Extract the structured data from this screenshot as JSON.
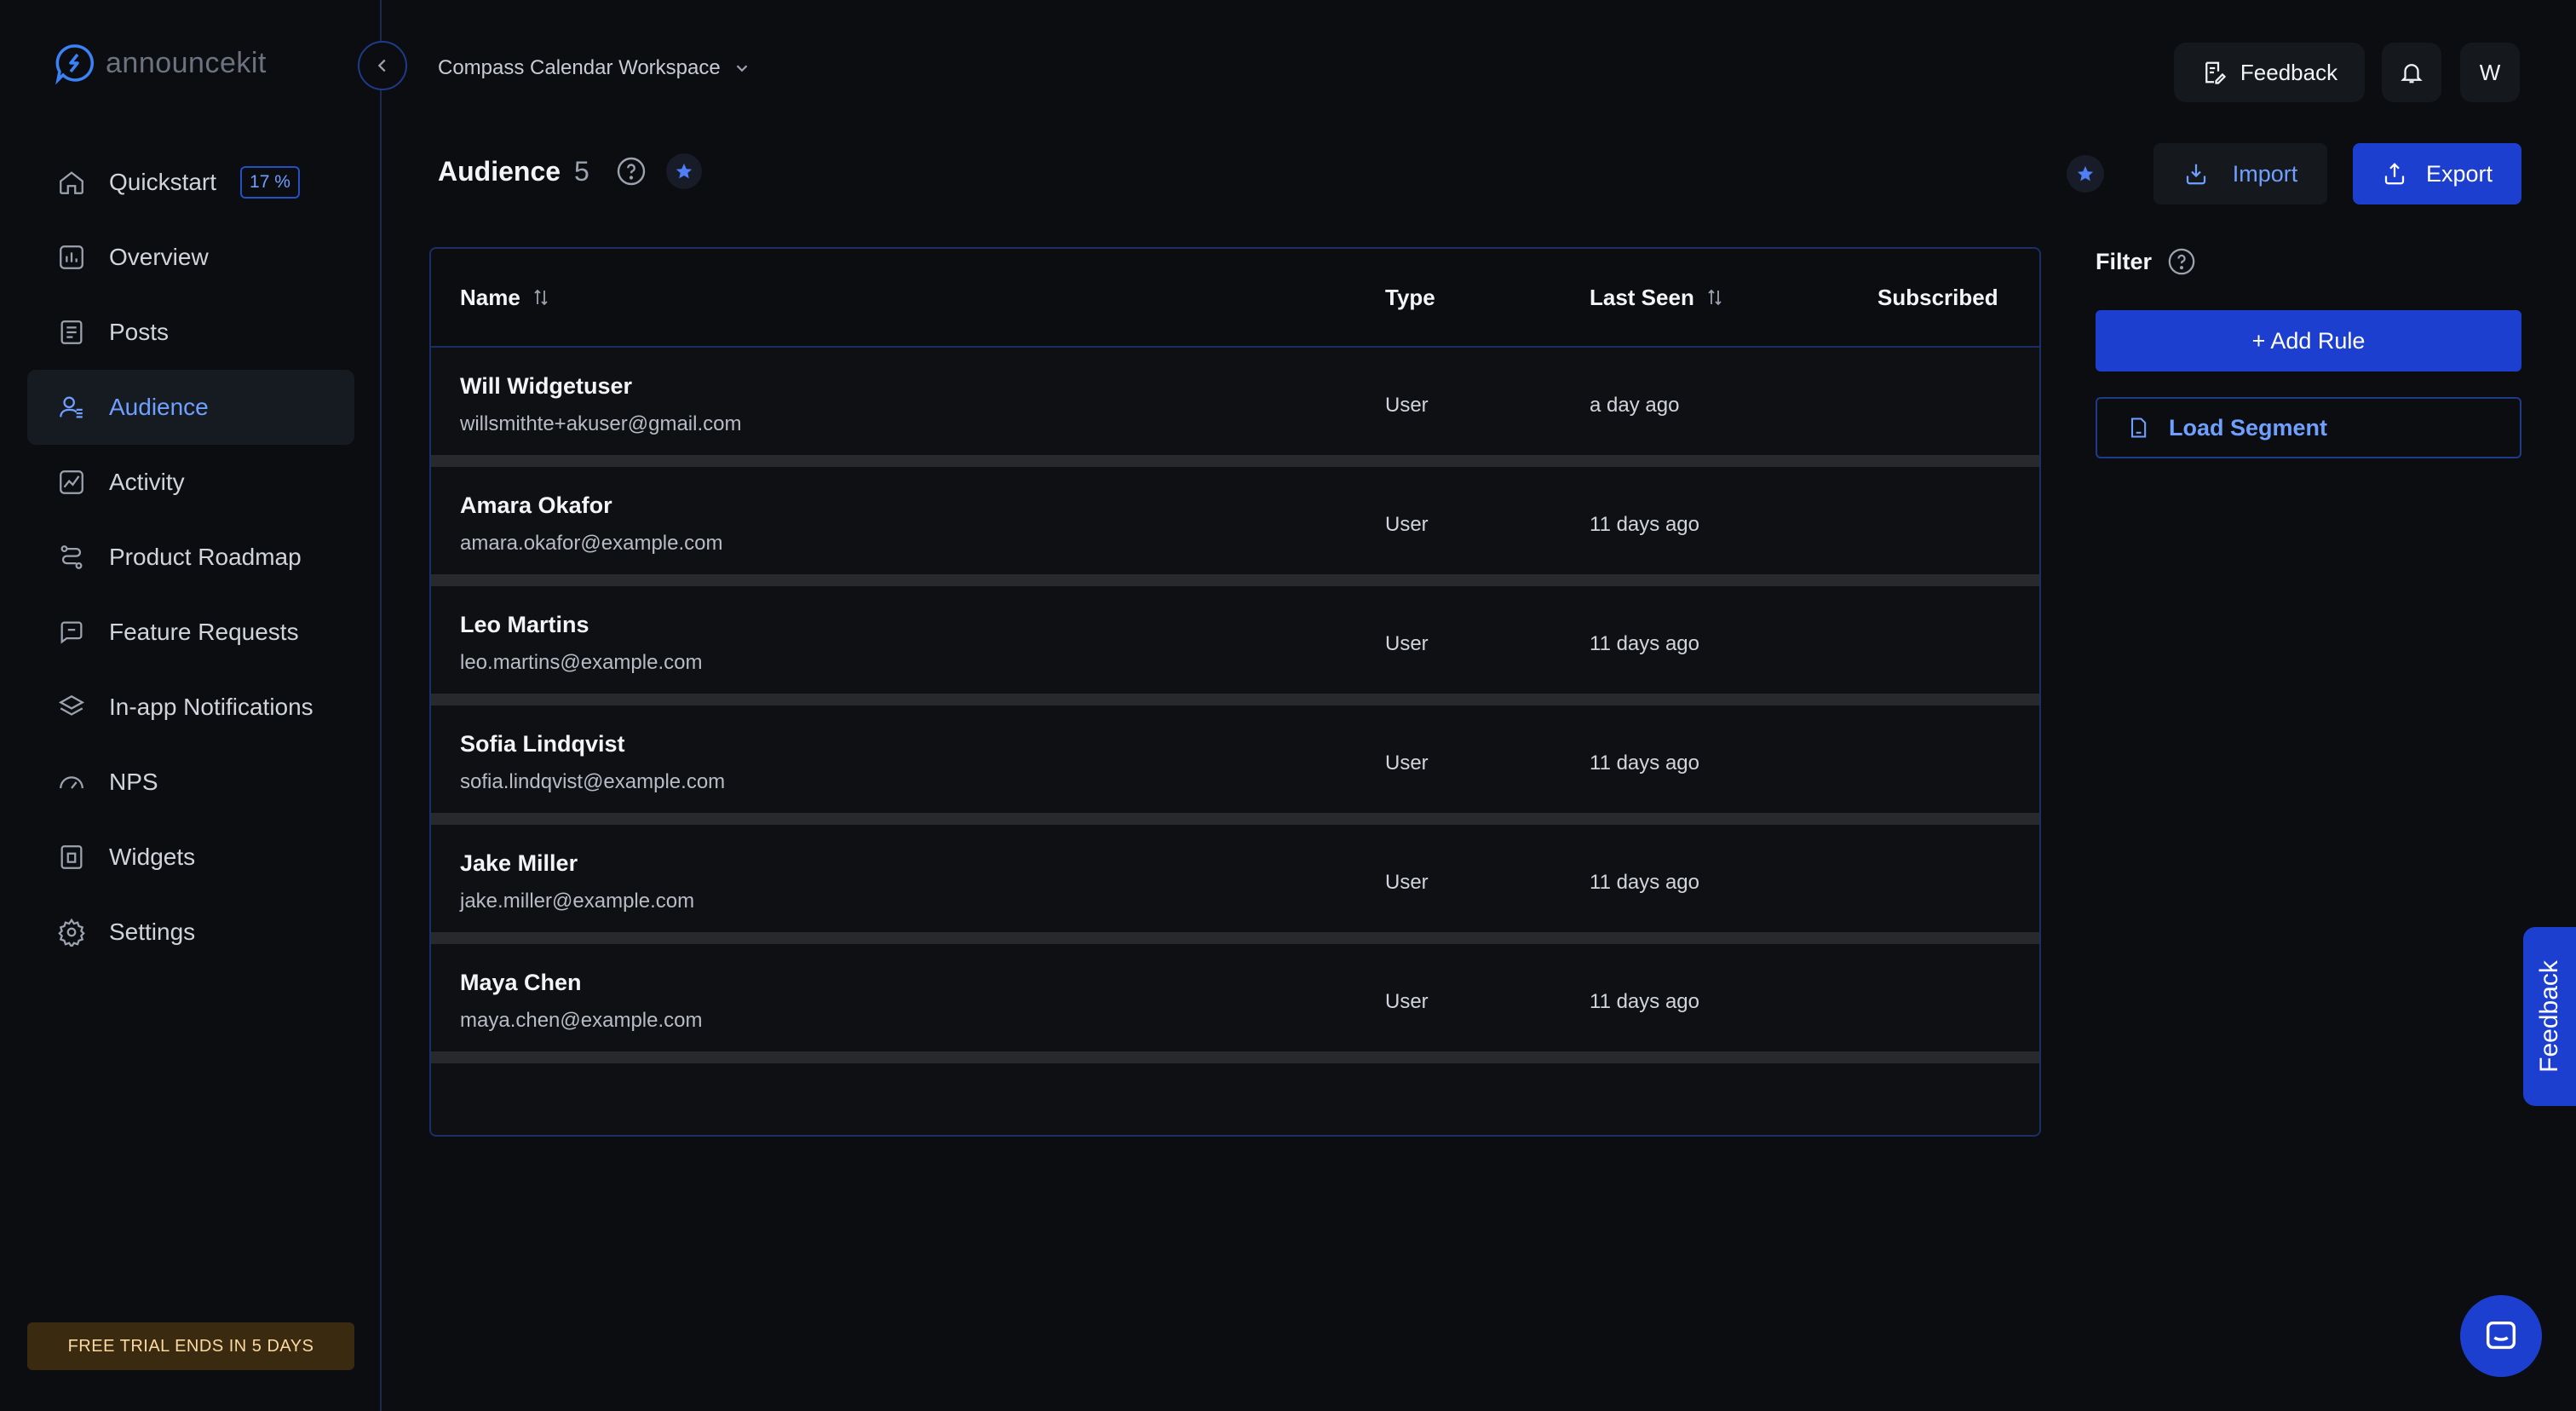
{
  "brand": {
    "name": "announcekit"
  },
  "sidebar": {
    "items": [
      {
        "label": "Quickstart",
        "icon": "home-icon",
        "badge": "17 %"
      },
      {
        "label": "Overview",
        "icon": "bar-chart-icon"
      },
      {
        "label": "Posts",
        "icon": "document-icon"
      },
      {
        "label": "Audience",
        "icon": "users-icon",
        "active": true
      },
      {
        "label": "Activity",
        "icon": "activity-chart-icon"
      },
      {
        "label": "Product Roadmap",
        "icon": "roadmap-icon"
      },
      {
        "label": "Feature Requests",
        "icon": "chat-bubble-icon"
      },
      {
        "label": "In-app Notifications",
        "icon": "layers-icon"
      },
      {
        "label": "NPS",
        "icon": "gauge-icon"
      },
      {
        "label": "Widgets",
        "icon": "widget-icon"
      },
      {
        "label": "Settings",
        "icon": "gear-icon"
      }
    ],
    "trial_banner": "FREE TRIAL ENDS IN 5 DAYS"
  },
  "header": {
    "workspace": "Compass Calendar Workspace",
    "feedback_label": "Feedback",
    "avatar_initial": "W"
  },
  "page": {
    "title": "Audience",
    "count": "5",
    "import_label": "Import",
    "export_label": "Export"
  },
  "table": {
    "columns": [
      "Name",
      "Type",
      "Last Seen",
      "Subscribed"
    ],
    "rows": [
      {
        "name": "Will Widgetuser",
        "email": "willsmithte+akuser@gmail.com",
        "type": "User",
        "last_seen": "a day ago"
      },
      {
        "name": "Amara Okafor",
        "email": "amara.okafor@example.com",
        "type": "User",
        "last_seen": "11 days ago"
      },
      {
        "name": "Leo Martins",
        "email": "leo.martins@example.com",
        "type": "User",
        "last_seen": "11 days ago"
      },
      {
        "name": "Sofia Lindqvist",
        "email": "sofia.lindqvist@example.com",
        "type": "User",
        "last_seen": "11 days ago"
      },
      {
        "name": "Jake Miller",
        "email": "jake.miller@example.com",
        "type": "User",
        "last_seen": "11 days ago"
      },
      {
        "name": "Maya Chen",
        "email": "maya.chen@example.com",
        "type": "User",
        "last_seen": "11 days ago"
      }
    ]
  },
  "filter": {
    "label": "Filter",
    "add_rule_label": "+ Add Rule",
    "load_segment_label": "Load Segment"
  },
  "side_feedback_label": "Feedback",
  "colors": {
    "accent": "#1d3fcf",
    "link": "#6fa0ff",
    "background": "#0b0d10",
    "trial": "#3a2a10"
  }
}
